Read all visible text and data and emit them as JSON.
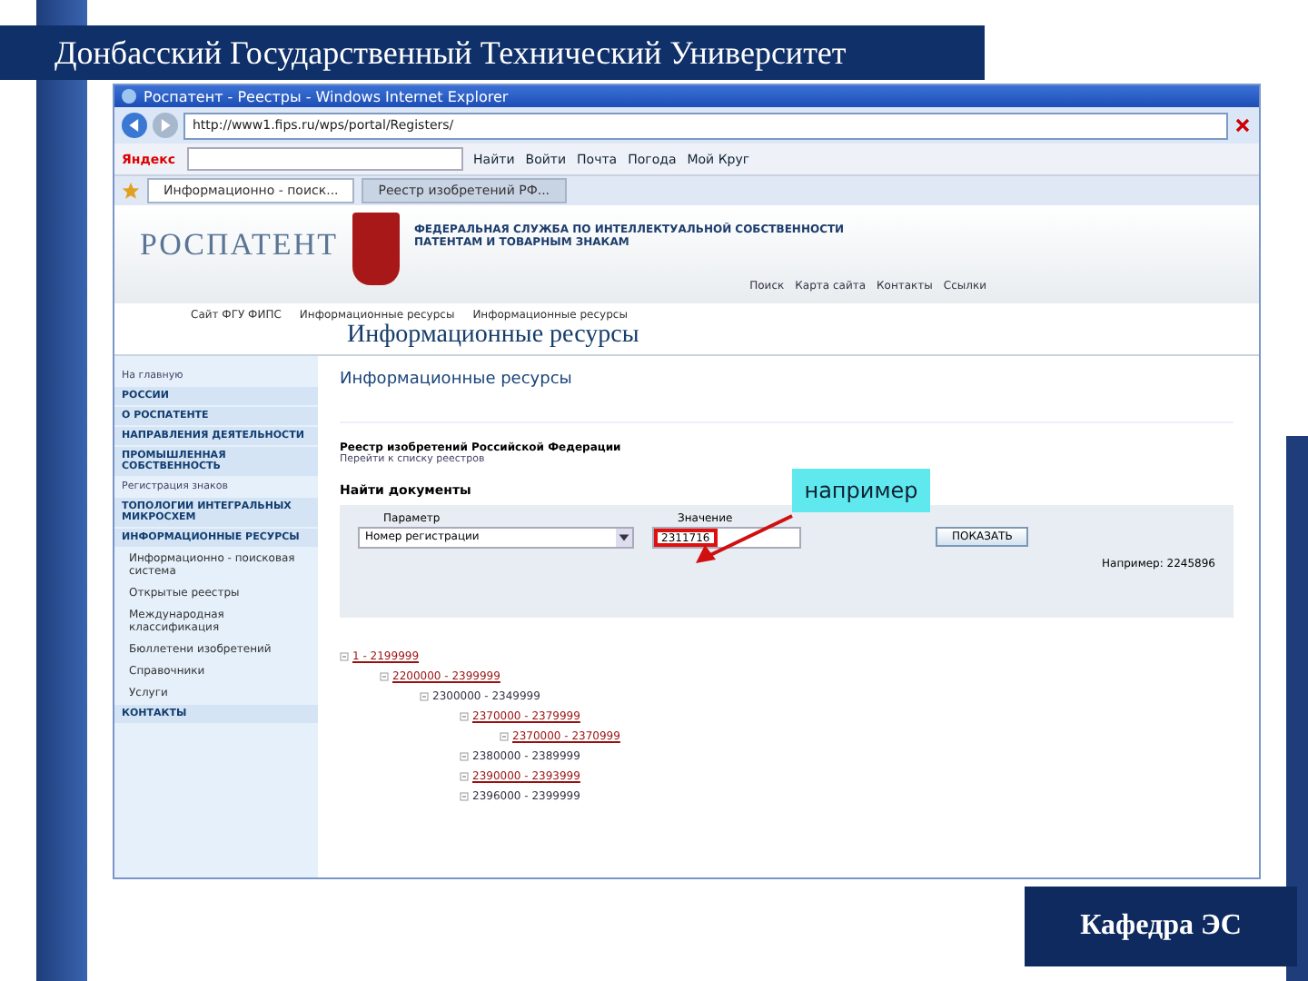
{
  "slide_title": "Донбасский Государственный Технический Университет",
  "browser": {
    "title": "Роспатент - Реестры - Windows Internet Explorer",
    "address": "http://www1.fips.ru/wps/portal/Registers/",
    "toolbar": [
      "Яндекс",
      "Найти",
      "Войти",
      "Почта",
      "Погода",
      "Мой Круг"
    ],
    "tabs": [
      {
        "label": "Информационно - поиск...",
        "selected": true
      },
      {
        "label": "Реестр изобретений РФ...",
        "selected": false
      }
    ]
  },
  "site": {
    "logo": "РОСПАТЕНТ",
    "agency": [
      "ФЕДЕРАЛЬНАЯ СЛУЖБА ПО ИНТЕЛЛЕКТУАЛЬНОЙ СОБСТВЕННОСТИ",
      "ПАТЕНТАМ И ТОВАРНЫМ ЗНАКАМ"
    ],
    "top_links": [
      "Поиск",
      "Карта сайта",
      "Контакты",
      "Ссылки"
    ],
    "breadcrumb": [
      "Сайт ФГУ ФИПС",
      "Информационные ресурсы",
      "Информационные ресурсы"
    ],
    "page_title": "Информационные ресурсы",
    "sidebar": [
      {
        "label": "На главную",
        "kind": "plain"
      },
      {
        "label": "РОССИИ",
        "kind": "section"
      },
      {
        "label": "О РОСПАТЕНТЕ",
        "kind": "section"
      },
      {
        "label": "НАПРАВЛЕНИЯ ДЕЯТЕЛЬНОСТИ",
        "kind": "section"
      },
      {
        "label": "ПРОМЫШЛЕННАЯ СОБСТВЕННОСТЬ",
        "kind": "section"
      },
      {
        "label": "Регистрация знаков",
        "kind": "plain"
      },
      {
        "label": "ТОПОЛОГИИ ИНТЕГРАЛЬНЫХ МИКРОСХЕМ",
        "kind": "section"
      },
      {
        "label": "ИНФОРМАЦИОННЫЕ РЕСУРСЫ",
        "kind": "section"
      },
      {
        "label": "Информационно - поисковая система",
        "kind": "sub"
      },
      {
        "label": "Открытые реестры",
        "kind": "sub"
      },
      {
        "label": "Международная классификация",
        "kind": "sub"
      },
      {
        "label": "Бюллетени изобретений",
        "kind": "sub"
      },
      {
        "label": "Справочники",
        "kind": "sub"
      },
      {
        "label": "Услуги",
        "kind": "sub"
      },
      {
        "label": "КОНТАКТЫ",
        "kind": "section"
      }
    ],
    "content_title": "Информационные ресурсы",
    "register_title": "Реестр изобретений Российской Федерации",
    "register_link": "Перейти к списку реестров",
    "search_title": "Найти документы",
    "param_label": "Параметр",
    "value_label": "Значение",
    "param_value": "Номер регистрации",
    "value": "2311716",
    "show_button": "ПОКАЗАТЬ",
    "example": "Например: 2245896",
    "callout": "например",
    "tree": [
      {
        "label": "1 - 2199999",
        "link": true,
        "children": [
          {
            "label": "2200000 - 2399999",
            "link": true,
            "children": [
              {
                "label": "2300000 - 2349999",
                "link": false,
                "children": [
                  {
                    "label": "2370000 - 2379999",
                    "link": true,
                    "children": [
                      {
                        "label": "2370000 - 2370999",
                        "link": true
                      }
                    ]
                  },
                  {
                    "label": "2380000 - 2389999",
                    "link": false
                  },
                  {
                    "label": "2390000 - 2393999",
                    "link": true
                  },
                  {
                    "label": "2396000 - 2399999",
                    "link": false
                  }
                ]
              }
            ]
          }
        ]
      }
    ]
  },
  "footer": "Кафедра ЭС"
}
